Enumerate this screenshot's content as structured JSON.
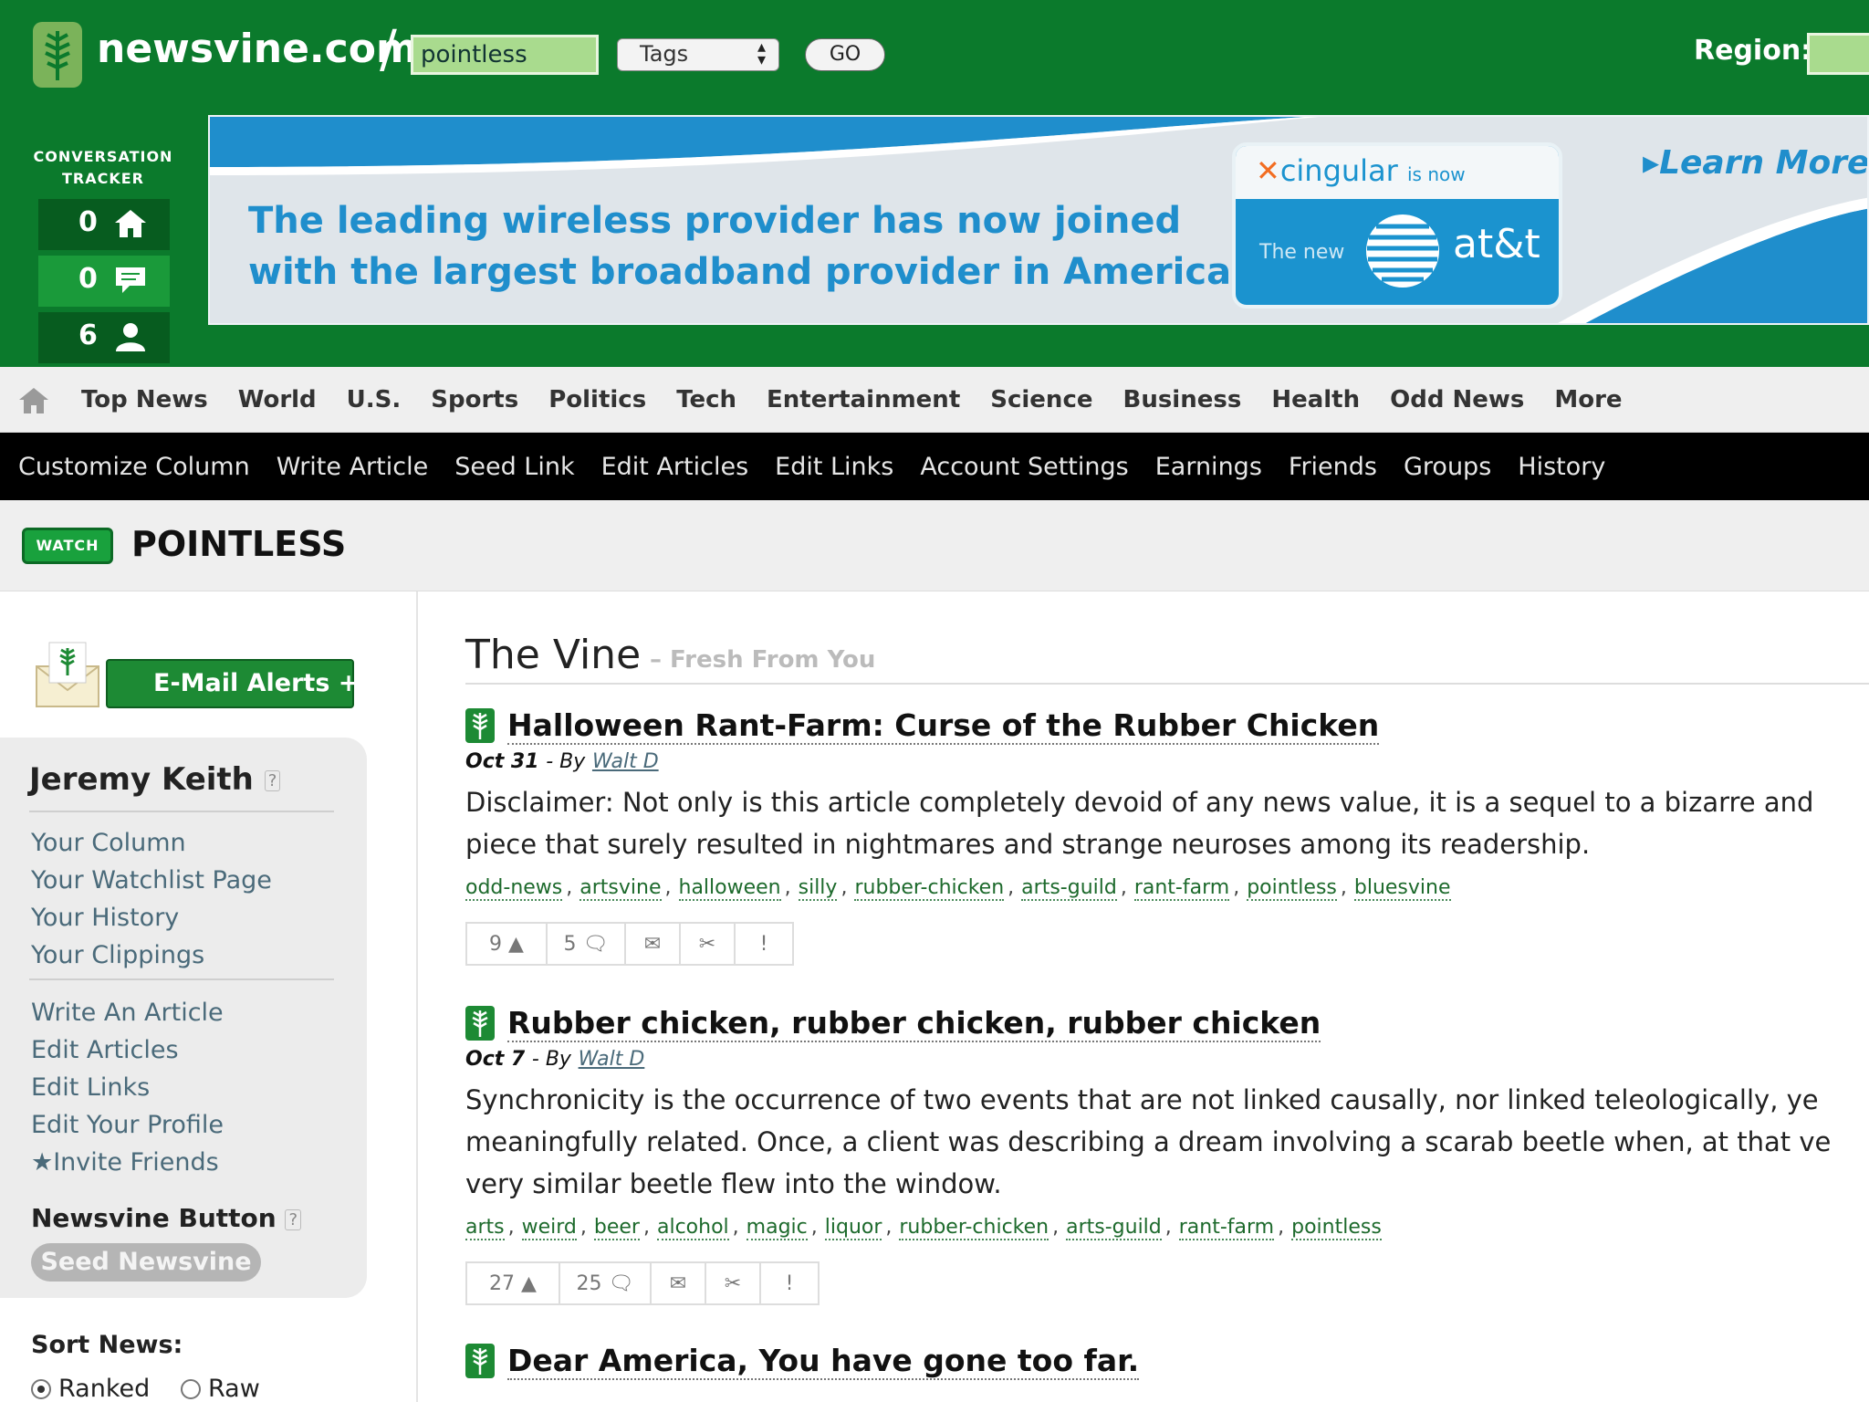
{
  "header": {
    "logo": "newsvine.com",
    "search_value": "pointless",
    "search_scope": "Tags",
    "go_label": "GO",
    "region_label": "Region:"
  },
  "tracker": {
    "title_line1": "CONVERSATION",
    "title_line2": "TRACKER",
    "rows": [
      {
        "count": "0",
        "icon": "home-icon"
      },
      {
        "count": "0",
        "icon": "speech-bubble-icon"
      },
      {
        "count": "6",
        "icon": "person-icon"
      }
    ]
  },
  "ad": {
    "headline_line1": "The leading wireless provider has now joined",
    "headline_line2": "with the largest broadband provider in America.",
    "cingular": "cingular",
    "is_now": "is now",
    "the_new": "The new",
    "att": "at&t",
    "learn_more": "Learn More"
  },
  "nav_primary": [
    "Top News",
    "World",
    "U.S.",
    "Sports",
    "Politics",
    "Tech",
    "Entertainment",
    "Science",
    "Business",
    "Health",
    "Odd News",
    "More"
  ],
  "nav_secondary": [
    "Customize Column",
    "Write Article",
    "Seed Link",
    "Edit Articles",
    "Edit Links",
    "Account Settings",
    "Earnings",
    "Friends",
    "Groups",
    "History"
  ],
  "tag_page": {
    "watch_label": "WATCH",
    "title": "POINTLESS"
  },
  "sidebar": {
    "email_alerts": "E-Mail Alerts +",
    "user_name": "Jeremy Keith",
    "help": "?",
    "links_group1": [
      "Your Column",
      "Your Watchlist Page",
      "Your History",
      "Your Clippings"
    ],
    "links_group2": [
      "Write An Article",
      "Edit Articles",
      "Edit Links",
      "Edit Your Profile",
      "Invite Friends"
    ],
    "newsvine_button_title": "Newsvine Button",
    "seed_label": "Seed Newsvine",
    "sort_title": "Sort News:",
    "sort_options": [
      "Ranked",
      "Raw"
    ],
    "sort_selected": "Ranked"
  },
  "main": {
    "section_title": "The Vine",
    "section_sub": "–  Fresh From You",
    "articles": [
      {
        "title": "Halloween Rant-Farm: Curse of the Rubber Chicken",
        "date": "Oct 31",
        "by": "- By",
        "author": "Walt D",
        "body_line1": "Disclaimer: Not only is this article completely devoid of any news value, it is a sequel to a bizarre and",
        "body_line2": "piece that surely resulted in nightmares and strange neuroses among its readership.",
        "tags": [
          "odd-news",
          "artsvine",
          "halloween",
          "silly",
          "rubber-chicken",
          "arts-guild",
          "rant-farm",
          "pointless",
          "bluesvine"
        ],
        "votes": "9",
        "comments": "5",
        "flag": "!"
      },
      {
        "title": "Rubber chicken, rubber chicken, rubber chicken",
        "date": "Oct 7",
        "by": "- By",
        "author": "Walt D",
        "body_line1": "Synchronicity is the occurrence of two events that are not linked causally, nor linked teleologically, ye",
        "body_line2": "meaningfully related. Once, a client was describing a dream involving a scarab beetle when, at that ve",
        "body_line3": "very similar beetle flew into the window.",
        "tags": [
          "arts",
          "weird",
          "beer",
          "alcohol",
          "magic",
          "liquor",
          "rubber-chicken",
          "arts-guild",
          "rant-farm",
          "pointless"
        ],
        "votes": "27",
        "comments": "25",
        "flag": "!"
      },
      {
        "title": "Dear America, You have gone too far."
      }
    ]
  }
}
